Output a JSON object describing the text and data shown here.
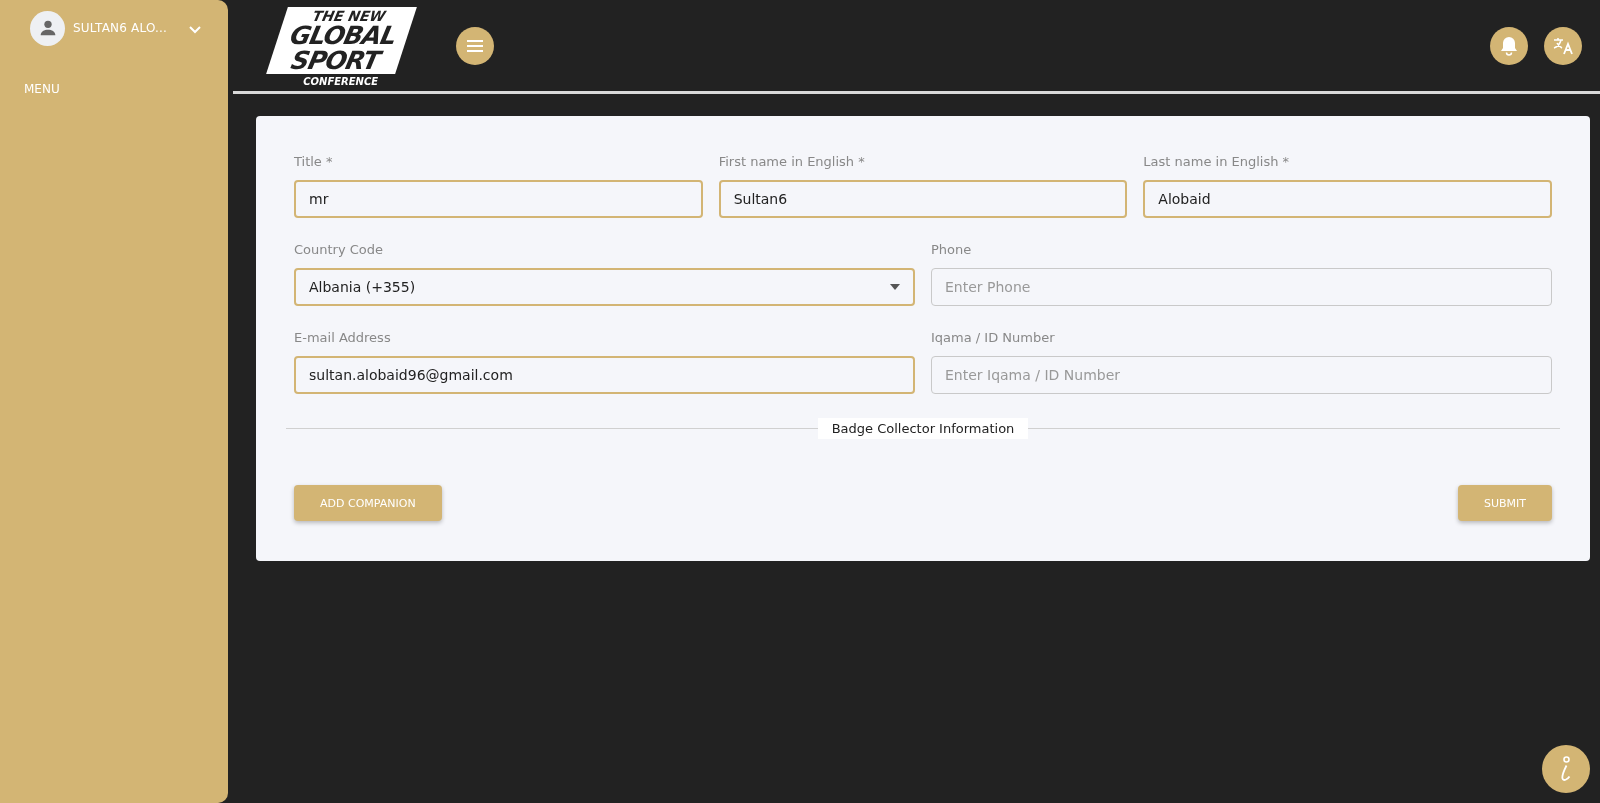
{
  "sidebar": {
    "user_name": "SULTAN6 ALO...",
    "menu_label": "MENU"
  },
  "header": {
    "logo": {
      "line_1": "THE NEW",
      "line_2": "GLOBAL",
      "line_3": "SPORT",
      "line_4": "CONFERENCE"
    }
  },
  "form": {
    "rows": [
      [
        {
          "label": "Title *",
          "kind": "text",
          "value": "mr"
        },
        {
          "label": "First name in English *",
          "kind": "text",
          "value": "Sultan6"
        },
        {
          "label": "Last name in English *",
          "kind": "text",
          "value": "Alobaid"
        }
      ],
      [
        {
          "label": "Country Code",
          "kind": "select",
          "value": "Albania (+355)"
        },
        {
          "label": "Phone",
          "kind": "text",
          "placeholder": "Enter Phone"
        }
      ],
      [
        {
          "label": "E-mail Address",
          "kind": "text",
          "value": "sultan.alobaid96@gmail.com"
        },
        {
          "label": "Iqama / ID Number",
          "kind": "text",
          "placeholder": "Enter Iqama / ID Number"
        }
      ]
    ],
    "section_title": "Badge Collector Information",
    "buttons": [
      {
        "label": "ADD COMPANION"
      },
      {
        "label": "SUBMIT"
      }
    ]
  }
}
